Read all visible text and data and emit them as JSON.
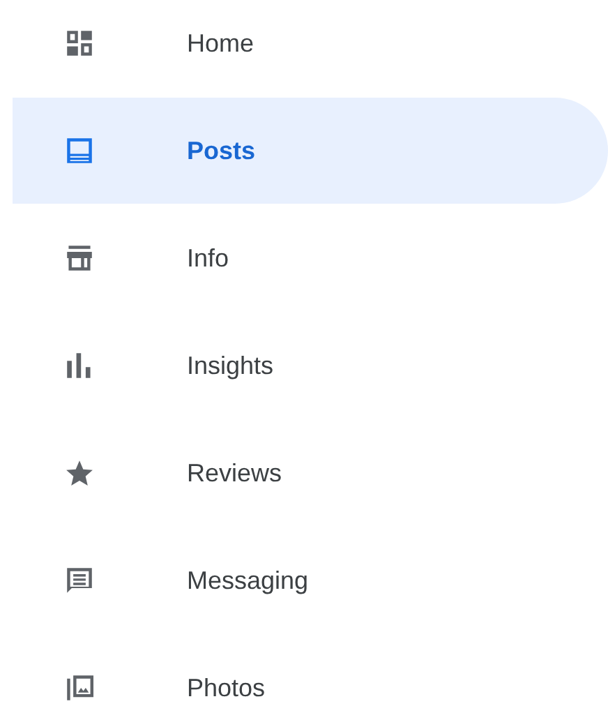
{
  "nav": {
    "items": [
      {
        "label": "Home",
        "selected": false
      },
      {
        "label": "Posts",
        "selected": true
      },
      {
        "label": "Info",
        "selected": false
      },
      {
        "label": "Insights",
        "selected": false
      },
      {
        "label": "Reviews",
        "selected": false
      },
      {
        "label": "Messaging",
        "selected": false
      },
      {
        "label": "Photos",
        "selected": false
      }
    ]
  }
}
